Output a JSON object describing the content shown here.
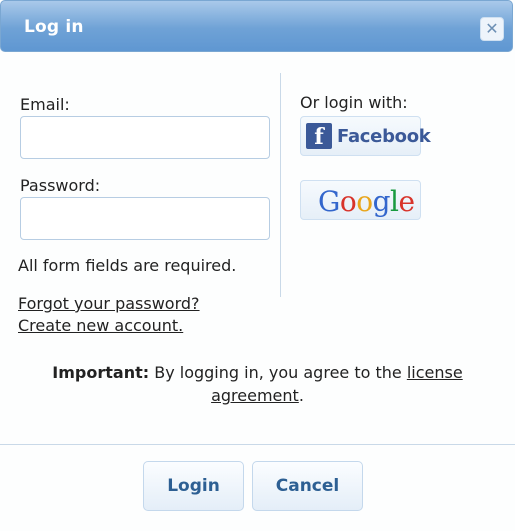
{
  "dialog": {
    "title": "Log in",
    "close_icon": "close-icon"
  },
  "form": {
    "email_label": "Email:",
    "email_value": "",
    "password_label": "Password:",
    "password_value": "",
    "required_note": "All form fields are required.",
    "forgot_link": "Forgot your password?",
    "create_link": "Create new account."
  },
  "social": {
    "heading": "Or login with:",
    "facebook_label": "Facebook",
    "facebook_icon": "facebook-f-icon",
    "google_letters": [
      "G",
      "o",
      "o",
      "g",
      "l",
      "e"
    ]
  },
  "important": {
    "bold": "Important:",
    "text": " By logging in, you agree to the ",
    "link": "license agreement",
    "end": "."
  },
  "buttons": {
    "login": "Login",
    "cancel": "Cancel"
  },
  "colors": {
    "titlebar": "#6fa2d6",
    "button_text": "#2d5f93",
    "facebook": "#3b5998"
  }
}
